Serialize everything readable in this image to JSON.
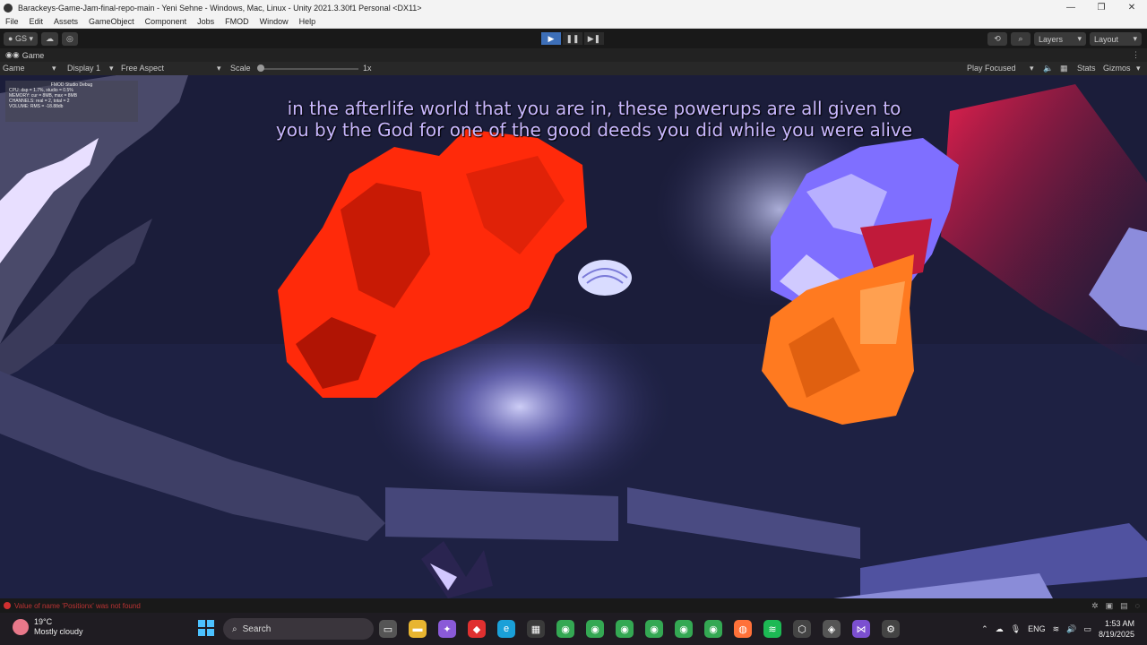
{
  "window": {
    "title": "Barackeys-Game-Jam-final-repo-main - Yeni Sehne - Windows, Mac, Linux - Unity 2021.3.30f1 Personal <DX11>",
    "min": "—",
    "max": "❐",
    "close": "✕"
  },
  "menu": [
    "File",
    "Edit",
    "Assets",
    "GameObject",
    "Component",
    "Jobs",
    "FMOD",
    "Window",
    "Help"
  ],
  "toolbar": {
    "account": "GS",
    "layers": "Layers",
    "layout": "Layout"
  },
  "tabs": {
    "game": "Game"
  },
  "game_toolbar": {
    "mode": "Game",
    "display": "Display 1",
    "aspect": "Free Aspect",
    "scale_label": "Scale",
    "scale_value": "1x",
    "play_focused": "Play Focused",
    "stats": "Stats",
    "gizmos": "Gizmos"
  },
  "debug_panel": {
    "title": "FMOD Studio Debug",
    "lines": [
      "CPU: dsp = 1.7%, studio = 0.5%",
      "MEMORY: cur = 8MB, max = 8MB",
      "CHANNELS: real = 2, total = 2",
      "VOLUME: RMS = -18.88db"
    ]
  },
  "subtitle": "in the afterlife world that you are in, these powerups are all given to you by the God for one of the good deeds you did while you were alive",
  "status": {
    "error": "Value of name 'Positionx' was not found"
  },
  "taskbar": {
    "temperature": "19°C",
    "weather": "Mostly cloudy",
    "search_placeholder": "Search",
    "language": "ENG",
    "time": "1:53 AM",
    "date": "8/19/2025"
  },
  "colors": {
    "play_active": "#3d6fb8",
    "subtitle": "#c9b8ff",
    "windows_accent": "#4cc2ff",
    "error": "#d03030"
  }
}
